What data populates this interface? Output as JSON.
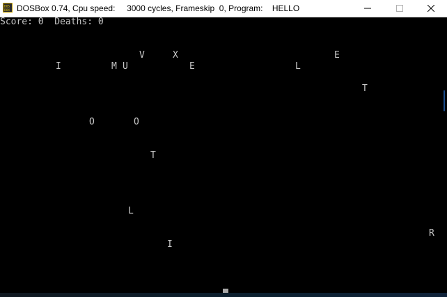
{
  "window": {
    "title": "DOSBox 0.74, Cpu speed:     3000 cycles, Frameskip  0, Program:    HELLO",
    "app_icon": "dosbox-icon",
    "buttons": {
      "minimize": "minimize-icon",
      "maximize": "maximize-icon",
      "close": "close-icon"
    }
  },
  "game": {
    "status": "Score: 0  Deaths: 0",
    "letters": [
      {
        "ch": "V"
      },
      {
        "ch": "X"
      },
      {
        "ch": "E"
      },
      {
        "ch": "I"
      },
      {
        "ch": "M"
      },
      {
        "ch": "U"
      },
      {
        "ch": "E"
      },
      {
        "ch": "L"
      },
      {
        "ch": "T"
      },
      {
        "ch": "O"
      },
      {
        "ch": "O"
      },
      {
        "ch": "T"
      },
      {
        "ch": "L"
      },
      {
        "ch": "I"
      },
      {
        "ch": "R"
      }
    ]
  },
  "colors": {
    "background": "#000000",
    "text": "#c8c8c8",
    "titlebar": "#ffffff"
  }
}
